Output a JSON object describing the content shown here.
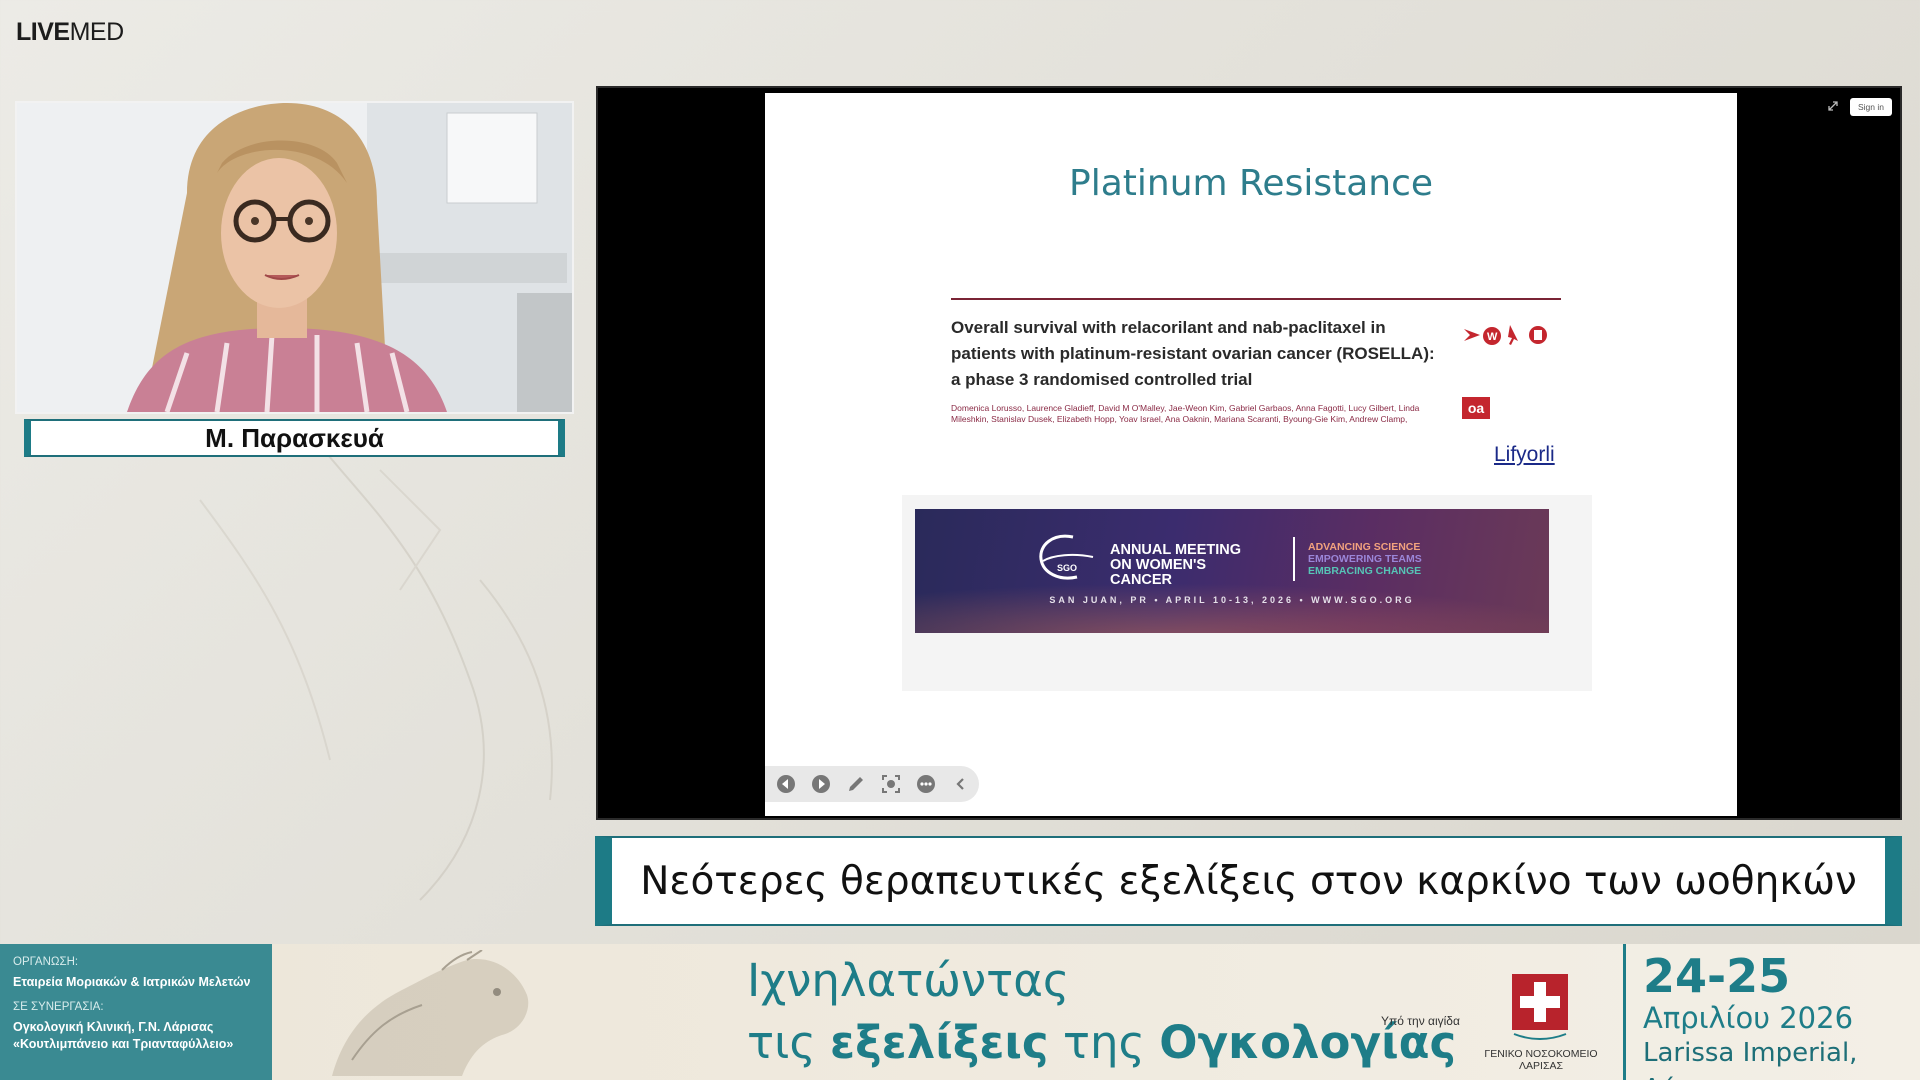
{
  "brand": {
    "live": "LIVE",
    "med": "MED"
  },
  "speaker": {
    "name": "Μ. Παρασκευά"
  },
  "screen": {
    "sign_in_label": "Sign in",
    "slide": {
      "title": "Platinum Resistance",
      "paper_title_lines": [
        "Overall survival with relacorilant and nab-paclitaxel in",
        "patients with platinum-resistant ovarian cancer (ROSELLA):",
        "a phase 3 randomised controlled trial"
      ],
      "paper_authors": "Domenica Lorusso, Laurence Gladieff, David M O'Malley, Jae-Weon Kim, Gabriel Garbaos, Anna Fagotti, Lucy Gilbert, Linda Mileshkin, Stanislav Dusek, Elizabeth Hopp, Yoav Israel, Ana Oaknin, Mariana Scaranti, Byoung-Gie Kim, Andrew Clamp, Christine Pellomen",
      "oa_badge": "oa",
      "drug_link": "Lifyorli",
      "banner": {
        "meeting_line1": "ANNUAL MEETING",
        "meeting_line2": "ON WOMEN'S CANCER",
        "tag1": "ADVANCING SCIENCE",
        "tag2": "EMPOWERING TEAMS",
        "tag3": "EMBRACING CHANGE",
        "footer": "SAN JUAN, PR  •  APRIL 10-13, 2026  •  WWW.SGO.ORG",
        "logo_text": "SGO"
      }
    },
    "toolbar_icons": [
      "prev-icon",
      "next-icon",
      "pen-icon",
      "screenshot-icon",
      "more-icon",
      "collapse-icon"
    ]
  },
  "lecture_title": "Νεότερες θεραπευτικές εξελίξεις στον καρκίνο των ωοθηκών",
  "footer": {
    "org_label": "ΟΡΓΑΝΩΣΗ:",
    "org_value": "Εταιρεία Μοριακών & Ιατρικών Μελετών",
    "collab_label": "ΣΕ ΣΥΝΕΡΓΑΣΙΑ:",
    "collab_line1": "Ογκολογική Κλινική,  Γ.Ν. Λάρισας",
    "collab_line2": "«Κουτλιμπάνειο  και Τριανταφύλλειο»",
    "event_line1": "Ιχνηλατώντας",
    "event_line2_a": "τις ",
    "event_line2_b": "εξελίξεις",
    "event_line2_c": " της ",
    "event_line2_d": "Ογκολογίας",
    "patronage": "Υπό την αιγίδα",
    "hospital": "ΓΕΝΙΚΟ ΝΟΣΟΚΟΜΕΙΟ ΛΑΡΙΣΑΣ",
    "days": "24-25",
    "month": "Απριλίου 2026",
    "venue": "Larissa Imperial, Λάρισα"
  },
  "colors": {
    "teal": "#1e7d88",
    "dark_red": "#7a2435",
    "banner_purple": "#3b2c6e"
  }
}
